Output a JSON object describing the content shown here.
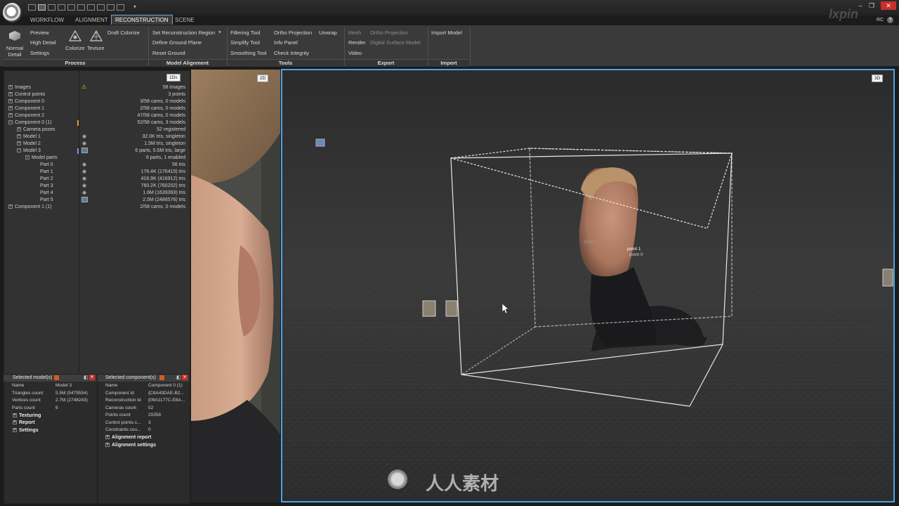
{
  "app": {
    "tabs": [
      "WORKFLOW",
      "ALIGNMENT",
      "RECONSTRUCTION",
      "SCENE"
    ],
    "active_tab": "RECONSTRUCTION",
    "corner_label": "RC",
    "watermark_corner": "lxpin"
  },
  "ribbon": {
    "process": {
      "normal_detail": "Normal Detail",
      "preview": "Preview",
      "high_detail": "High Detail",
      "settings": "Settings",
      "colorize": "Colorize",
      "texture": "Texture",
      "draft_colorize": "Draft Colorize",
      "label": "Process"
    },
    "model_alignment": {
      "set_region": "Set Reconstruction Region",
      "define_ground": "Define Ground Plane",
      "reset_ground": "Reset Ground",
      "label": "Model Alignment"
    },
    "tools": {
      "filtering": "Filtering Tool",
      "simplify": "Simplify Tool",
      "smoothing": "Smoothing Tool",
      "ortho_projection": "Ortho Projection",
      "unwrap": "Unwrap",
      "info_panel": "Info Panel",
      "check_integrity": "Check Integrity",
      "label": "Tools"
    },
    "export": {
      "mesh": "Mesh",
      "render": "Render",
      "video": "Video",
      "ortho_projection": "Ortho Projection",
      "dsm": "Digital Surface Model",
      "label": "Export"
    },
    "import": {
      "import_model": "Import Model",
      "label": "Import"
    }
  },
  "tree": {
    "badge": "1Ds",
    "rows": [
      {
        "label": "Images",
        "value": "58 images"
      },
      {
        "label": "Control points",
        "value": "3 points"
      },
      {
        "label": "Component 0",
        "value": "3/58 cams, 0 models"
      },
      {
        "label": "Component 1",
        "value": "2/58 cams, 0 models"
      },
      {
        "label": "Component 2",
        "value": "47/58 cams, 0 models"
      },
      {
        "label": "Component 0 (1)",
        "value": "52/58 cams, 3 models"
      },
      {
        "label": "Camera poses",
        "value": "52 registered"
      },
      {
        "label": "Model 1",
        "value": "32.0K tris, singleton"
      },
      {
        "label": "Model 2",
        "value": "1.5M tris, singleton"
      },
      {
        "label": "Model 3",
        "value": "6 parts, 5.5M tris, large"
      },
      {
        "label": "Model parts",
        "value": "6 parts, 1 enabled"
      },
      {
        "label": "Part 0",
        "value": "56 tris"
      },
      {
        "label": "Part 1",
        "value": "176.4K (176415) tris"
      },
      {
        "label": "Part 2",
        "value": "416.9K (416912) tris"
      },
      {
        "label": "Part 3",
        "value": "760.2K (760202) tris"
      },
      {
        "label": "Part 4",
        "value": "1.6M (1639393) tris"
      },
      {
        "label": "Part 5",
        "value": "2.5M (2486576) tris"
      },
      {
        "label": "Component 1 (1)",
        "value": "2/58 cams, 0 models"
      }
    ]
  },
  "selected_models": {
    "title": "Selected model(s)",
    "rows": [
      {
        "label": "Name",
        "value": "Model 3"
      },
      {
        "label": "Triangles count",
        "value": "5.5M (5479554)"
      },
      {
        "label": "Vertices count",
        "value": "2.7M (2748243)"
      },
      {
        "label": "Parts count",
        "value": "6"
      }
    ],
    "sections": [
      "Texturing",
      "Report",
      "Settings"
    ]
  },
  "selected_components": {
    "title": "Selected component(s)",
    "rows": [
      {
        "label": "Name",
        "value": "Component 0 (1)"
      },
      {
        "label": "Component Id",
        "value": "{C8A43DAE-B2..."
      },
      {
        "label": "Reconstruction Id",
        "value": "{09A1177C-E8A..."
      },
      {
        "label": "Cameras count",
        "value": "52"
      },
      {
        "label": "Points count",
        "value": "20358"
      },
      {
        "label": "Control points c...",
        "value": "3"
      },
      {
        "label": "Constraints cou...",
        "value": "0"
      }
    ],
    "sections": [
      "Alignment report",
      "Alignment settings"
    ]
  },
  "view2d": {
    "badge": "2D"
  },
  "view3d": {
    "badge": "3D",
    "points": [
      "point 1",
      "point 0",
      "point 2"
    ],
    "watermark": "人人素材"
  },
  "colors": {
    "accent": "#4da3e6",
    "close": "#c9302c",
    "warning": "#e8c020"
  }
}
